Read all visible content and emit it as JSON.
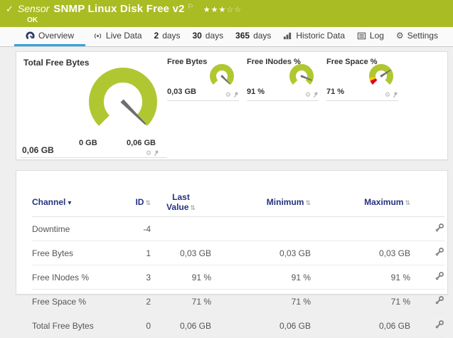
{
  "colors": {
    "header_green": "#a9bc23",
    "gauge_green": "#b1c732",
    "active_tab_blue": "#35a2dc",
    "table_header_navy": "#27327f",
    "warning_yellow": "#f4c800",
    "error_red": "#dd0029",
    "needle_gray": "#6e6e6e"
  },
  "header": {
    "status_check": "✓",
    "kind": "Sensor",
    "title": "SNMP Linux Disk Free v2",
    "flag": "⚐",
    "stars_filled": "★★★",
    "stars_empty": "☆☆",
    "status_text": "OK"
  },
  "tabs": {
    "overview": "Overview",
    "live_data": "Live Data",
    "d2_num": "2",
    "d2_unit": "days",
    "d30_num": "30",
    "d30_unit": "days",
    "d365_num": "365",
    "d365_unit": "days",
    "historic": "Historic Data",
    "log": "Log",
    "settings": "Settings",
    "settings_gear": "⚙"
  },
  "overview_panel": {
    "tool_gear": "⚙",
    "main_gauge": {
      "title": "Total Free Bytes",
      "value": "0,06 GB",
      "scale_min": "0 GB",
      "scale_max": "0,06 GB",
      "needle_deg": 45
    },
    "small_gauges": [
      {
        "title": "Free Bytes",
        "value": "0,03 GB",
        "needle_deg": 45
      },
      {
        "title": "Free INodes %",
        "value": "91 %",
        "needle_deg": 22
      },
      {
        "title": "Free Space %",
        "value": "71 %",
        "needle_deg": -33
      }
    ]
  },
  "channel_table": {
    "col_channel": "Channel",
    "col_id": "ID",
    "col_last_line1": "Last",
    "col_last_line2": "Value",
    "col_min": "Minimum",
    "col_max": "Maximum",
    "sort_desc_glyph": "▾",
    "sort_glyph": "⇅",
    "rows": [
      {
        "channel": "Downtime",
        "id": "-4",
        "last": "",
        "min": "",
        "max": ""
      },
      {
        "channel": "Free Bytes",
        "id": "1",
        "last": "0,03 GB",
        "min": "0,03 GB",
        "max": "0,03 GB"
      },
      {
        "channel": "Free INodes %",
        "id": "3",
        "last": "91 %",
        "min": "91 %",
        "max": "91 %"
      },
      {
        "channel": "Free Space %",
        "id": "2",
        "last": "71 %",
        "min": "71 %",
        "max": "71 %"
      },
      {
        "channel": "Total Free Bytes",
        "id": "0",
        "last": "0,06 GB",
        "min": "0,06 GB",
        "max": "0,06 GB"
      }
    ]
  }
}
